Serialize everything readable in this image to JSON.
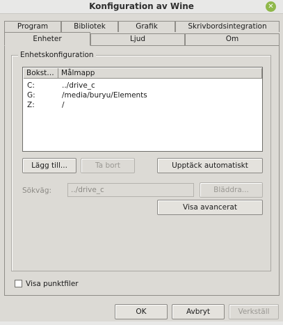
{
  "window": {
    "title": "Konfiguration av Wine"
  },
  "tabs_row1": [
    "Program",
    "Bibliotek",
    "Grafik",
    "Skrivbordsintegration"
  ],
  "tabs_row2": [
    "Enheter",
    "Ljud",
    "Om"
  ],
  "active_tab": "Enheter",
  "group": {
    "label": "Enhetskonfiguration"
  },
  "drive_list": {
    "columns": [
      "Bokst…",
      "Målmapp"
    ],
    "rows": [
      {
        "letter": "C:",
        "path": "../drive_c"
      },
      {
        "letter": "G:",
        "path": "/media/buryu/Elements"
      },
      {
        "letter": "Z:",
        "path": "/"
      }
    ]
  },
  "buttons": {
    "add": "Lägg till...",
    "remove": "Ta bort",
    "autodetect": "Upptäck automatiskt",
    "browse": "Bläddra...",
    "advanced": "Visa avancerat"
  },
  "path_field": {
    "label": "Sökväg:",
    "value": "../drive_c"
  },
  "show_dotfiles": {
    "label": "Visa punktfiler",
    "checked": false
  },
  "footer": {
    "ok": "OK",
    "cancel": "Avbryt",
    "apply": "Verkställ"
  }
}
